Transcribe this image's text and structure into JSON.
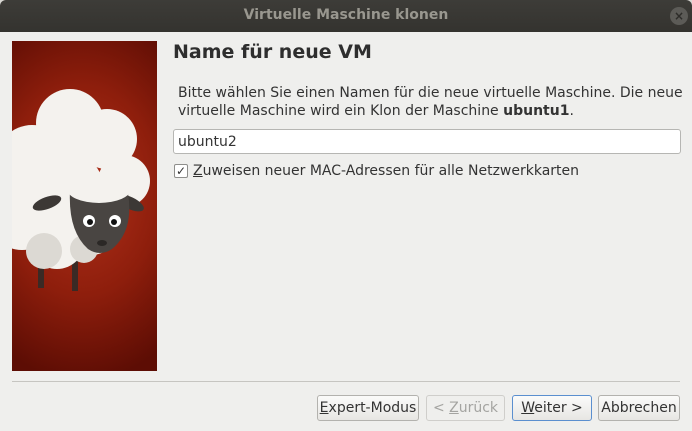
{
  "window": {
    "title": "Virtuelle Maschine klonen",
    "close_glyph": "×",
    "close_icon": "close-icon"
  },
  "page": {
    "heading": "Name für neue VM",
    "description_prefix": "Bitte wählen Sie einen Namen für die neue virtuelle Maschine. Die neue virtuelle Maschine wird ein Klon der Maschine ",
    "source_vm": "ubuntu1",
    "description_suffix": "."
  },
  "name_field": {
    "value": "ubuntu2"
  },
  "mac_option": {
    "checked": true,
    "check_glyph": "✓",
    "mnemonic": "Z",
    "label_rest": "uweisen neuer MAC-Adressen für alle Netzwerkkarten"
  },
  "buttons": {
    "expert": {
      "pre": "",
      "mnemonic": "E",
      "post": "xpert-Modus",
      "enabled": true
    },
    "back": {
      "pre": "< ",
      "mnemonic": "Z",
      "post": "urück",
      "enabled": false
    },
    "next": {
      "pre": "",
      "mnemonic": "W",
      "post": "eiter >",
      "enabled": true
    },
    "cancel": {
      "pre": "",
      "mnemonic": "",
      "post": "Abbrechen",
      "enabled": true
    }
  },
  "banner": {
    "icon": "sheep-mascot-icon"
  }
}
